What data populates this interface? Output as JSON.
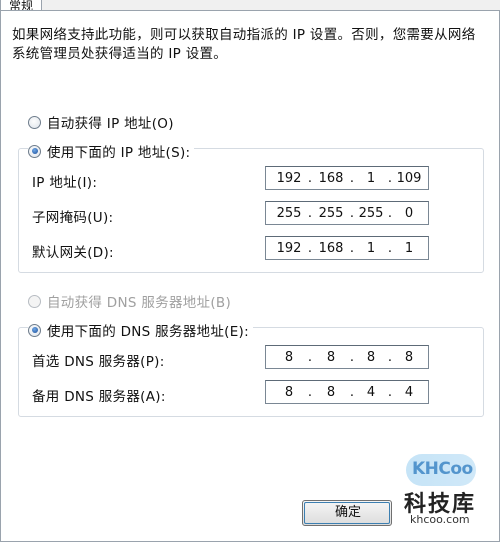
{
  "tab": {
    "label": "常规"
  },
  "intro_text": "如果网络支持此功能，则可以获取自动指派的 IP 设置。否则，您需要从网络系统管理员处获得适当的 IP 设置。",
  "ip_settings": {
    "auto_option": {
      "label": "自动获得 IP 地址(O)",
      "selected": false
    },
    "manual_option": {
      "label": "使用下面的 IP 地址(S):",
      "selected": true
    },
    "fields": [
      {
        "label": "IP 地址(I):",
        "octets": [
          "192",
          "168",
          "1",
          "109"
        ]
      },
      {
        "label": "子网掩码(U):",
        "octets": [
          "255",
          "255",
          "255",
          "0"
        ]
      },
      {
        "label": "默认网关(D):",
        "octets": [
          "192",
          "168",
          "1",
          "1"
        ]
      }
    ]
  },
  "dns_settings": {
    "auto_option": {
      "label": "自动获得 DNS 服务器地址(B)",
      "selected": false,
      "disabled": true
    },
    "manual_option": {
      "label": "使用下面的 DNS 服务器地址(E):",
      "selected": true
    },
    "fields": [
      {
        "label": "首选 DNS 服务器(P):",
        "octets": [
          "8",
          "8",
          "8",
          "8"
        ]
      },
      {
        "label": "备用 DNS 服务器(A):",
        "octets": [
          "8",
          "8",
          "4",
          "4"
        ]
      }
    ]
  },
  "buttons": {
    "ok_label": "确定"
  },
  "watermark": {
    "logo_text": "KHCoo",
    "title": "科技库",
    "url": "khcoo.com"
  }
}
